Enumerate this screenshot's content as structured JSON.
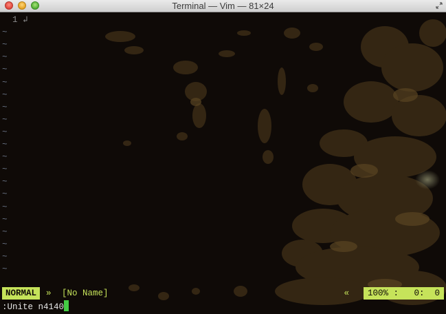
{
  "window": {
    "title": "Terminal — Vim — 81×24"
  },
  "buffer": {
    "line_number": "1",
    "line_content": "↲",
    "tilde": "~",
    "tilde_rows": 20
  },
  "statusline": {
    "mode": "NORMAL",
    "right_arrow": "»",
    "filename": "[No Name]",
    "left_arrow": "«",
    "ruler": "100% :   0:  0"
  },
  "commandline": {
    "text": ":Unite n4140"
  },
  "colors": {
    "accent": "#c6e35a",
    "background": "#0f0a07",
    "tilde": "#6a7486",
    "cursor": "#44cc44"
  }
}
